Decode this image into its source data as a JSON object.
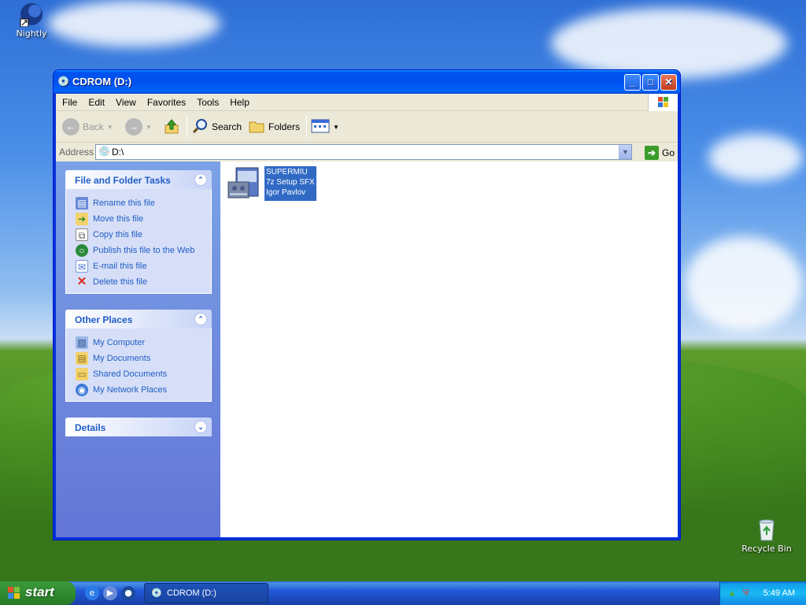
{
  "desktop": {
    "icons": [
      {
        "label": "Nightly",
        "icon": "nightly-globe-icon"
      },
      {
        "label": "Recycle Bin",
        "icon": "recycle-bin-icon"
      }
    ]
  },
  "window": {
    "title": "CDROM (D:)",
    "menu": [
      "File",
      "Edit",
      "View",
      "Favorites",
      "Tools",
      "Help"
    ],
    "toolbar": {
      "back_label": "Back",
      "search_label": "Search",
      "folders_label": "Folders"
    },
    "address": {
      "label": "Address",
      "value": "D:\\",
      "go_label": "Go"
    },
    "tasks_panel": {
      "title": "File and Folder Tasks",
      "items": [
        {
          "label": "Rename this file",
          "icon": "rename-icon"
        },
        {
          "label": "Move this file",
          "icon": "move-icon"
        },
        {
          "label": "Copy this file",
          "icon": "copy-icon"
        },
        {
          "label": "Publish this file to the Web",
          "icon": "globe-icon"
        },
        {
          "label": "E-mail this file",
          "icon": "email-icon"
        },
        {
          "label": "Delete this file",
          "icon": "delete-icon"
        }
      ]
    },
    "places_panel": {
      "title": "Other Places",
      "items": [
        {
          "label": "My Computer",
          "icon": "computer-icon"
        },
        {
          "label": "My Documents",
          "icon": "documents-icon"
        },
        {
          "label": "Shared Documents",
          "icon": "shared-folder-icon"
        },
        {
          "label": "My Network Places",
          "icon": "network-icon"
        }
      ]
    },
    "details_panel": {
      "title": "Details"
    },
    "file": {
      "lines": [
        "SUPERMIU",
        "7z Setup SFX",
        "Igor Pavlov"
      ]
    }
  },
  "taskbar": {
    "start_label": "start",
    "task_label": "CDROM (D:)",
    "clock": "5:49 AM"
  },
  "colors": {
    "title_blue": "#0053ee",
    "link_blue": "#215dc6",
    "selection": "#316ac5",
    "start_green": "#2f8a2f"
  }
}
